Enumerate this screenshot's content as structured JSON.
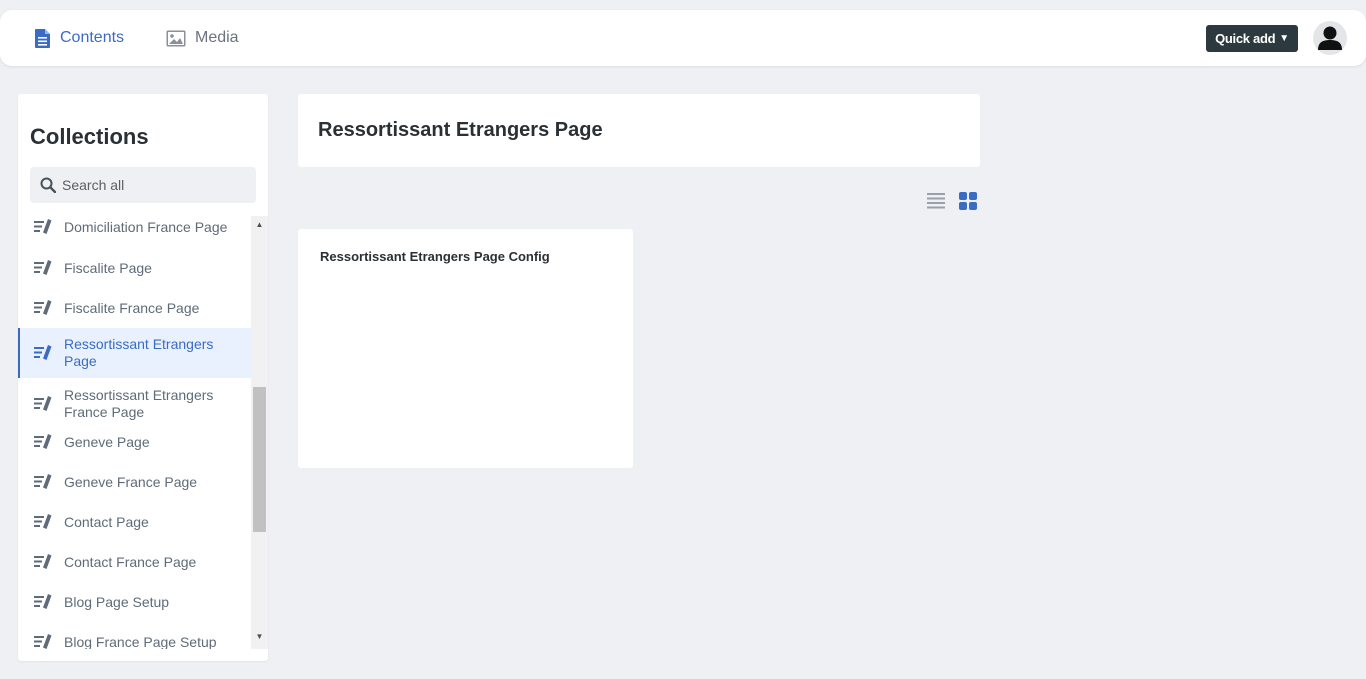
{
  "nav": {
    "contents_label": "Contents",
    "media_label": "Media",
    "quick_add_label": "Quick add"
  },
  "sidebar": {
    "title": "Collections",
    "search_placeholder": "Search all",
    "items": [
      {
        "label": "Domiciliation France Page",
        "active": false
      },
      {
        "label": "Fiscalite Page",
        "active": false
      },
      {
        "label": "Fiscalite France Page",
        "active": false
      },
      {
        "label": "Ressortissant Etrangers Page",
        "active": true
      },
      {
        "label": "Ressortissant Etrangers France Page",
        "active": false
      },
      {
        "label": "Geneve Page",
        "active": false
      },
      {
        "label": "Geneve France Page",
        "active": false
      },
      {
        "label": "Contact Page",
        "active": false
      },
      {
        "label": "Contact France Page",
        "active": false
      },
      {
        "label": "Blog Page Setup",
        "active": false
      },
      {
        "label": "Blog France Page Setup",
        "active": false
      }
    ]
  },
  "main": {
    "title": "Ressortissant Etrangers Page",
    "active_view": "grid",
    "cards": [
      {
        "title": "Ressortissant Etrangers Page Config"
      }
    ]
  },
  "colors": {
    "accent": "#3a6cc4",
    "background": "#eef0f4",
    "quick_add_bg": "#2c3a40",
    "active_item_bg": "#e8f1fd"
  }
}
